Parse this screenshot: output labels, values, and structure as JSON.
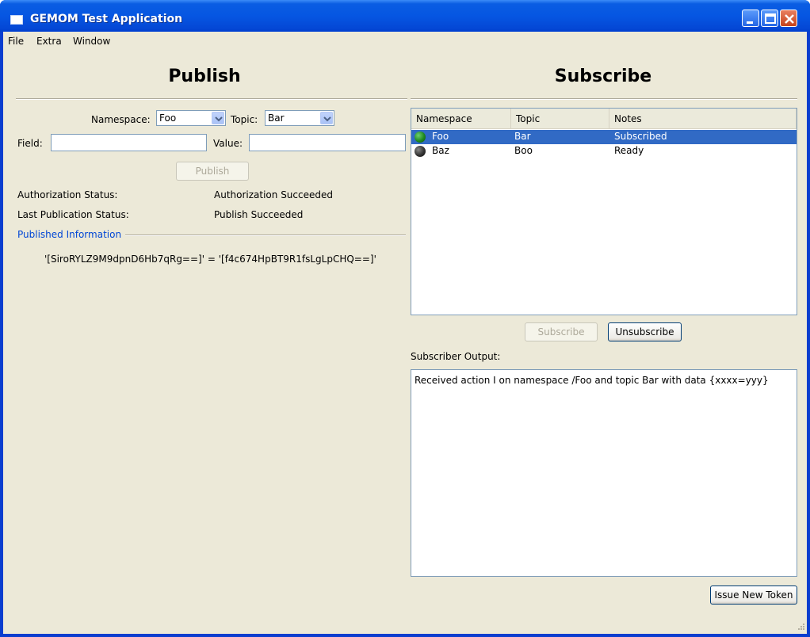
{
  "window": {
    "title": "GEMOM Test Application"
  },
  "menu": {
    "items": [
      "File",
      "Extra",
      "Window"
    ]
  },
  "publish": {
    "heading": "Publish",
    "namespace_label": "Namespace:",
    "namespace_value": "Foo",
    "topic_label": "Topic:",
    "topic_value": "Bar",
    "field_label": "Field:",
    "field_value": "",
    "value_label": "Value:",
    "value_value": "",
    "publish_button": "Publish",
    "auth_status_label": "Authorization Status:",
    "auth_status_value": "Authorization Succeeded",
    "last_pub_label": "Last Publication Status:",
    "last_pub_value": "Publish Succeeded",
    "published_info_title": "Published Information",
    "published_info_text": "'[SiroRYLZ9M9dpnD6Hb7qRg==]' = '[f4c674HpBT9R1fsLgLpCHQ==]'"
  },
  "subscribe": {
    "heading": "Subscribe",
    "columns": [
      "Namespace",
      "Topic",
      "Notes"
    ],
    "rows": [
      {
        "namespace": "Foo",
        "topic": "Bar",
        "notes": "Subscribed",
        "status": "green",
        "selected": true
      },
      {
        "namespace": "Baz",
        "topic": "Boo",
        "notes": "Ready",
        "status": "dark",
        "selected": false
      }
    ],
    "subscribe_button": "Subscribe",
    "unsubscribe_button": "Unsubscribe",
    "output_label": "Subscriber Output:",
    "output_text": "Received action I on namespace /Foo and topic Bar with data {xxxx=yyy}",
    "issue_token_button": "Issue New Token"
  },
  "colors": {
    "selection": "#316ac5",
    "led_green": "#1f8a1f",
    "led_dark": "#333333",
    "group_title": "#0046d5"
  }
}
